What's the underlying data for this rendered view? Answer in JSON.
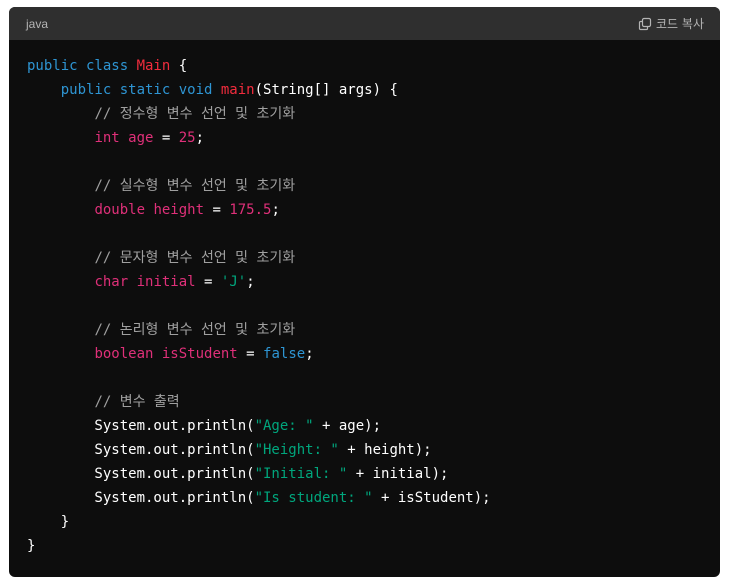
{
  "header": {
    "language": "java",
    "copy_label": "코드 복사"
  },
  "colors": {
    "background": "#0d0d0d",
    "header": "#2f2f2f",
    "keyword": "#2e95d3",
    "type": "#df3079",
    "string": "#00a67d",
    "comment": "#a0a0a0"
  },
  "code_lines": [
    [
      [
        "keyword",
        "public class "
      ],
      [
        "classname",
        "Main"
      ],
      [
        "plain",
        " {"
      ]
    ],
    [
      [
        "plain",
        "    "
      ],
      [
        "keyword",
        "public static void "
      ],
      [
        "func",
        "main"
      ],
      [
        "plain",
        "(String[] args) {"
      ]
    ],
    [
      [
        "plain",
        "        "
      ],
      [
        "comment",
        "// 정수형 변수 선언 및 초기화"
      ]
    ],
    [
      [
        "plain",
        "        "
      ],
      [
        "type",
        "int "
      ],
      [
        "var",
        "age"
      ],
      [
        "plain",
        " = "
      ],
      [
        "number",
        "25"
      ],
      [
        "plain",
        ";"
      ]
    ],
    [
      [
        "plain",
        ""
      ]
    ],
    [
      [
        "plain",
        "        "
      ],
      [
        "comment",
        "// 실수형 변수 선언 및 초기화"
      ]
    ],
    [
      [
        "plain",
        "        "
      ],
      [
        "type",
        "double "
      ],
      [
        "var",
        "height"
      ],
      [
        "plain",
        " = "
      ],
      [
        "number",
        "175.5"
      ],
      [
        "plain",
        ";"
      ]
    ],
    [
      [
        "plain",
        ""
      ]
    ],
    [
      [
        "plain",
        "        "
      ],
      [
        "comment",
        "// 문자형 변수 선언 및 초기화"
      ]
    ],
    [
      [
        "plain",
        "        "
      ],
      [
        "type",
        "char "
      ],
      [
        "var",
        "initial"
      ],
      [
        "plain",
        " = "
      ],
      [
        "string",
        "'J'"
      ],
      [
        "plain",
        ";"
      ]
    ],
    [
      [
        "plain",
        ""
      ]
    ],
    [
      [
        "plain",
        "        "
      ],
      [
        "comment",
        "// 논리형 변수 선언 및 초기화"
      ]
    ],
    [
      [
        "plain",
        "        "
      ],
      [
        "type",
        "boolean "
      ],
      [
        "var",
        "isStudent"
      ],
      [
        "plain",
        " = "
      ],
      [
        "keyword",
        "false"
      ],
      [
        "plain",
        ";"
      ]
    ],
    [
      [
        "plain",
        ""
      ]
    ],
    [
      [
        "plain",
        "        "
      ],
      [
        "comment",
        "// 변수 출력"
      ]
    ],
    [
      [
        "plain",
        "        System.out.println("
      ],
      [
        "string",
        "\"Age: \""
      ],
      [
        "plain",
        " + age);"
      ]
    ],
    [
      [
        "plain",
        "        System.out.println("
      ],
      [
        "string",
        "\"Height: \""
      ],
      [
        "plain",
        " + height);"
      ]
    ],
    [
      [
        "plain",
        "        System.out.println("
      ],
      [
        "string",
        "\"Initial: \""
      ],
      [
        "plain",
        " + initial);"
      ]
    ],
    [
      [
        "plain",
        "        System.out.println("
      ],
      [
        "string",
        "\"Is student: \""
      ],
      [
        "plain",
        " + isStudent);"
      ]
    ],
    [
      [
        "plain",
        "    }"
      ]
    ],
    [
      [
        "plain",
        "}"
      ]
    ]
  ]
}
